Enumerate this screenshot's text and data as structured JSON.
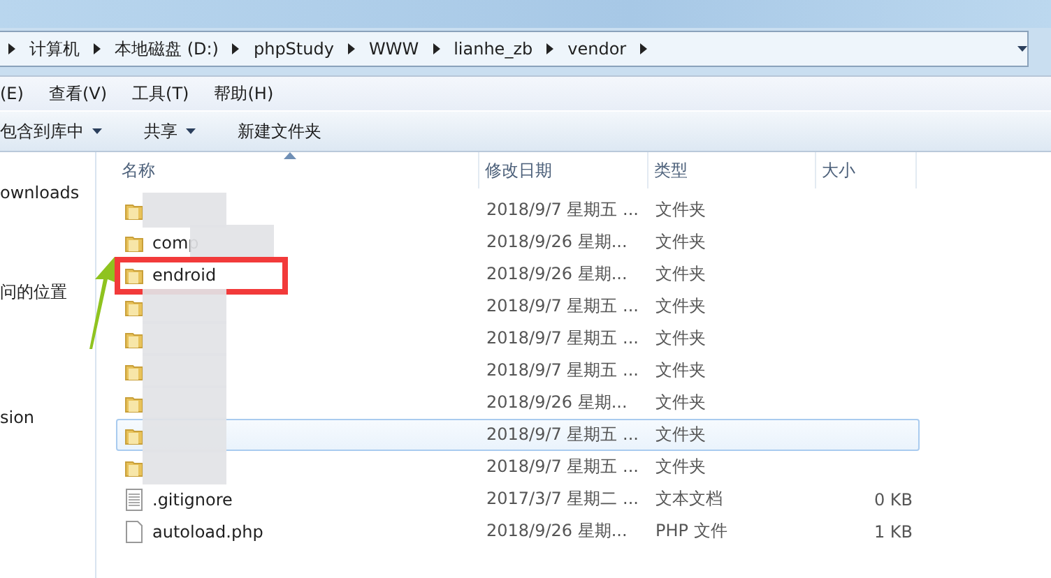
{
  "breadcrumb": [
    "计算机",
    "本地磁盘 (D:)",
    "phpStudy",
    "WWW",
    "lianhe_zb",
    "vendor"
  ],
  "menu": [
    "(E)",
    "查看(V)",
    "工具(T)",
    "帮助(H)"
  ],
  "toolbar": [
    {
      "label": "包含到库中",
      "dropdown": true
    },
    {
      "label": "共享",
      "dropdown": true
    },
    {
      "label": "新建文件夹",
      "dropdown": false
    }
  ],
  "nav": [
    "ownloads",
    "问的位置",
    "sion"
  ],
  "columns": [
    "名称",
    "修改日期",
    "类型",
    "大小"
  ],
  "rows": [
    {
      "kind": "folder",
      "redacted": true,
      "annotated": false,
      "selected": false,
      "date": "2018/9/7 星期五 ...",
      "type": "文件夹"
    },
    {
      "kind": "folder",
      "name": "comp",
      "redacted": true,
      "annotated": false,
      "selected": false,
      "date": "2018/9/26 星期...",
      "type": "文件夹"
    },
    {
      "kind": "folder",
      "name": "endroid",
      "redacted": false,
      "annotated": true,
      "selected": false,
      "date": "2018/9/26 星期...",
      "type": "文件夹"
    },
    {
      "kind": "folder",
      "redacted": true,
      "annotated": false,
      "selected": false,
      "date": "2018/9/7 星期五 ...",
      "type": "文件夹"
    },
    {
      "kind": "folder",
      "redacted": true,
      "annotated": false,
      "selected": false,
      "date": "2018/9/7 星期五 ...",
      "type": "文件夹"
    },
    {
      "kind": "folder",
      "redacted": true,
      "annotated": false,
      "selected": false,
      "date": "2018/9/7 星期五 ...",
      "type": "文件夹"
    },
    {
      "kind": "folder",
      "redacted": true,
      "annotated": false,
      "selected": false,
      "date": "2018/9/26 星期...",
      "type": "文件夹"
    },
    {
      "kind": "folder",
      "redacted": true,
      "annotated": false,
      "selected": true,
      "date": "2018/9/7 星期五 ...",
      "type": "文件夹"
    },
    {
      "kind": "folder",
      "redacted": true,
      "annotated": false,
      "selected": false,
      "date": "2018/9/7 星期五 ...",
      "type": "文件夹"
    },
    {
      "kind": "text",
      "name": ".gitignore",
      "redacted": false,
      "annotated": false,
      "selected": false,
      "date": "2017/3/7 星期二 ...",
      "type": "文本文档",
      "size": "0 KB"
    },
    {
      "kind": "file",
      "name": "autoload.php",
      "redacted": false,
      "annotated": false,
      "selected": false,
      "date": "2018/9/26 星期...",
      "type": "PHP 文件",
      "size": "1 KB"
    }
  ]
}
